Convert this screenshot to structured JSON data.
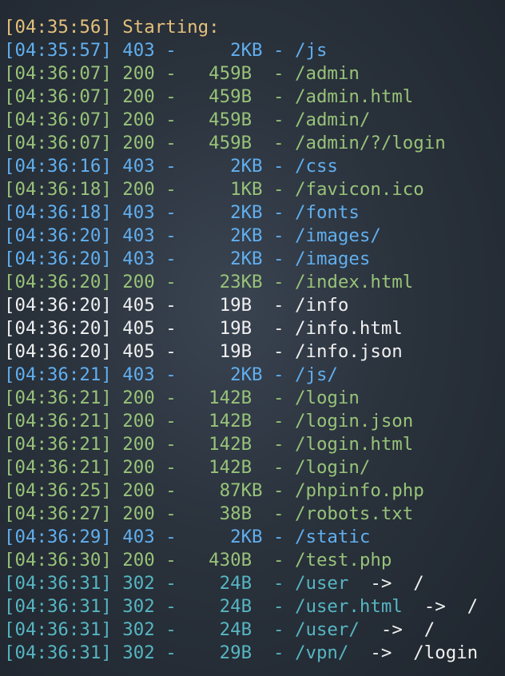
{
  "lines": [
    {
      "ts": "[04:35:56]",
      "text": " Starting:",
      "status_class": "start"
    },
    {
      "ts": "[04:35:57]",
      "text": " 403 -     2KB - /js",
      "status_class": "403"
    },
    {
      "ts": "[04:36:07]",
      "text": " 200 -   459B  - /admin",
      "status_class": "200"
    },
    {
      "ts": "[04:36:07]",
      "text": " 200 -   459B  - /admin.html",
      "status_class": "200"
    },
    {
      "ts": "[04:36:07]",
      "text": " 200 -   459B  - /admin/",
      "status_class": "200"
    },
    {
      "ts": "[04:36:07]",
      "text": " 200 -   459B  - /admin/?/login",
      "status_class": "200"
    },
    {
      "ts": "[04:36:16]",
      "text": " 403 -     2KB - /css",
      "status_class": "403"
    },
    {
      "ts": "[04:36:18]",
      "text": " 200 -     1KB - /favicon.ico",
      "status_class": "200"
    },
    {
      "ts": "[04:36:18]",
      "text": " 403 -     2KB - /fonts",
      "status_class": "403"
    },
    {
      "ts": "[04:36:20]",
      "text": " 403 -     2KB - /images/",
      "status_class": "403"
    },
    {
      "ts": "[04:36:20]",
      "text": " 403 -     2KB - /images",
      "status_class": "403"
    },
    {
      "ts": "[04:36:20]",
      "text": " 200 -    23KB - /index.html",
      "status_class": "200"
    },
    {
      "ts": "[04:36:20]",
      "text": " 405 -    19B  - /info",
      "status_class": "405"
    },
    {
      "ts": "[04:36:20]",
      "text": " 405 -    19B  - /info.html",
      "status_class": "405"
    },
    {
      "ts": "[04:36:20]",
      "text": " 405 -    19B  - /info.json",
      "status_class": "405"
    },
    {
      "ts": "[04:36:21]",
      "text": " 403 -     2KB - /js/",
      "status_class": "403"
    },
    {
      "ts": "[04:36:21]",
      "text": " 200 -   142B  - /login",
      "status_class": "200"
    },
    {
      "ts": "[04:36:21]",
      "text": " 200 -   142B  - /login.json",
      "status_class": "200"
    },
    {
      "ts": "[04:36:21]",
      "text": " 200 -   142B  - /login.html",
      "status_class": "200"
    },
    {
      "ts": "[04:36:21]",
      "text": " 200 -   142B  - /login/",
      "status_class": "200"
    },
    {
      "ts": "[04:36:25]",
      "text": " 200 -    87KB - /phpinfo.php",
      "status_class": "200"
    },
    {
      "ts": "[04:36:27]",
      "text": " 200 -    38B  - /robots.txt",
      "status_class": "200"
    },
    {
      "ts": "[04:36:29]",
      "text": " 403 -     2KB - /static",
      "status_class": "403"
    },
    {
      "ts": "[04:36:30]",
      "text": " 200 -   430B  - /test.php",
      "status_class": "200"
    },
    {
      "ts": "[04:36:31]",
      "text": " 302 -    24B  - /user",
      "status_class": "302",
      "redirect": "  ->  /"
    },
    {
      "ts": "[04:36:31]",
      "text": " 302 -    24B  - /user.html",
      "status_class": "302",
      "redirect": "  ->  /"
    },
    {
      "ts": "[04:36:31]",
      "text": " 302 -    24B  - /user/",
      "status_class": "302",
      "redirect": "  ->  /"
    },
    {
      "ts": "[04:36:31]",
      "text": " 302 -    29B  - /vpn/",
      "status_class": "302",
      "redirect": "  ->  /login"
    }
  ],
  "colors": {
    "start": "#e5c07b",
    "status_403": "#61afef",
    "status_200": "#98c379",
    "status_405": "#f0f0f0",
    "status_302": "#56b6c2",
    "redirect": "#f0f0f0",
    "background": "#2a323c"
  }
}
